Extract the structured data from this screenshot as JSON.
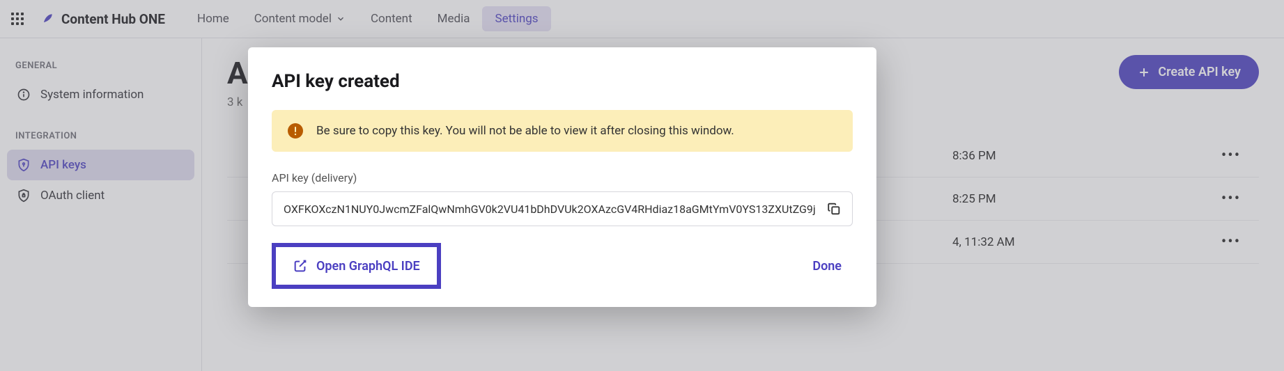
{
  "nav": {
    "brand": "Content Hub ONE",
    "items": [
      {
        "label": "Home"
      },
      {
        "label": "Content model",
        "dropdown": true
      },
      {
        "label": "Content"
      },
      {
        "label": "Media"
      },
      {
        "label": "Settings",
        "active": true
      }
    ]
  },
  "sidebar": {
    "sections": [
      {
        "label": "GENERAL",
        "items": [
          {
            "label": "System information",
            "icon": "info"
          }
        ]
      },
      {
        "label": "INTEGRATION",
        "items": [
          {
            "label": "API keys",
            "icon": "shield-key",
            "active": true
          },
          {
            "label": "OAuth client",
            "icon": "shield-lock"
          }
        ]
      }
    ]
  },
  "page": {
    "title": "A",
    "sub": "3 k",
    "create_button": "Create API key",
    "rows": [
      {
        "name": "",
        "date": "8:36 PM"
      },
      {
        "name": "",
        "date": "8:25 PM"
      },
      {
        "name": "",
        "date": "4, 11:32 AM"
      }
    ]
  },
  "modal": {
    "title": "API key created",
    "alert": "Be sure to copy this key. You will not be able to view it after closing this window.",
    "field_label": "API key (delivery)",
    "key_value": "OXFKOXczN1NUY0JwcmZFalQwNmhGV0k2VU41bDhDVUk2OXAzcGV4RHdiaz18aGMtYmV0YS13ZXUtZG9j",
    "open_ide": "Open GraphQL IDE",
    "done": "Done"
  },
  "colors": {
    "accent": "#4b3fc1",
    "alert_bg": "#fceeb9",
    "alert_icon": "#b85c00"
  }
}
